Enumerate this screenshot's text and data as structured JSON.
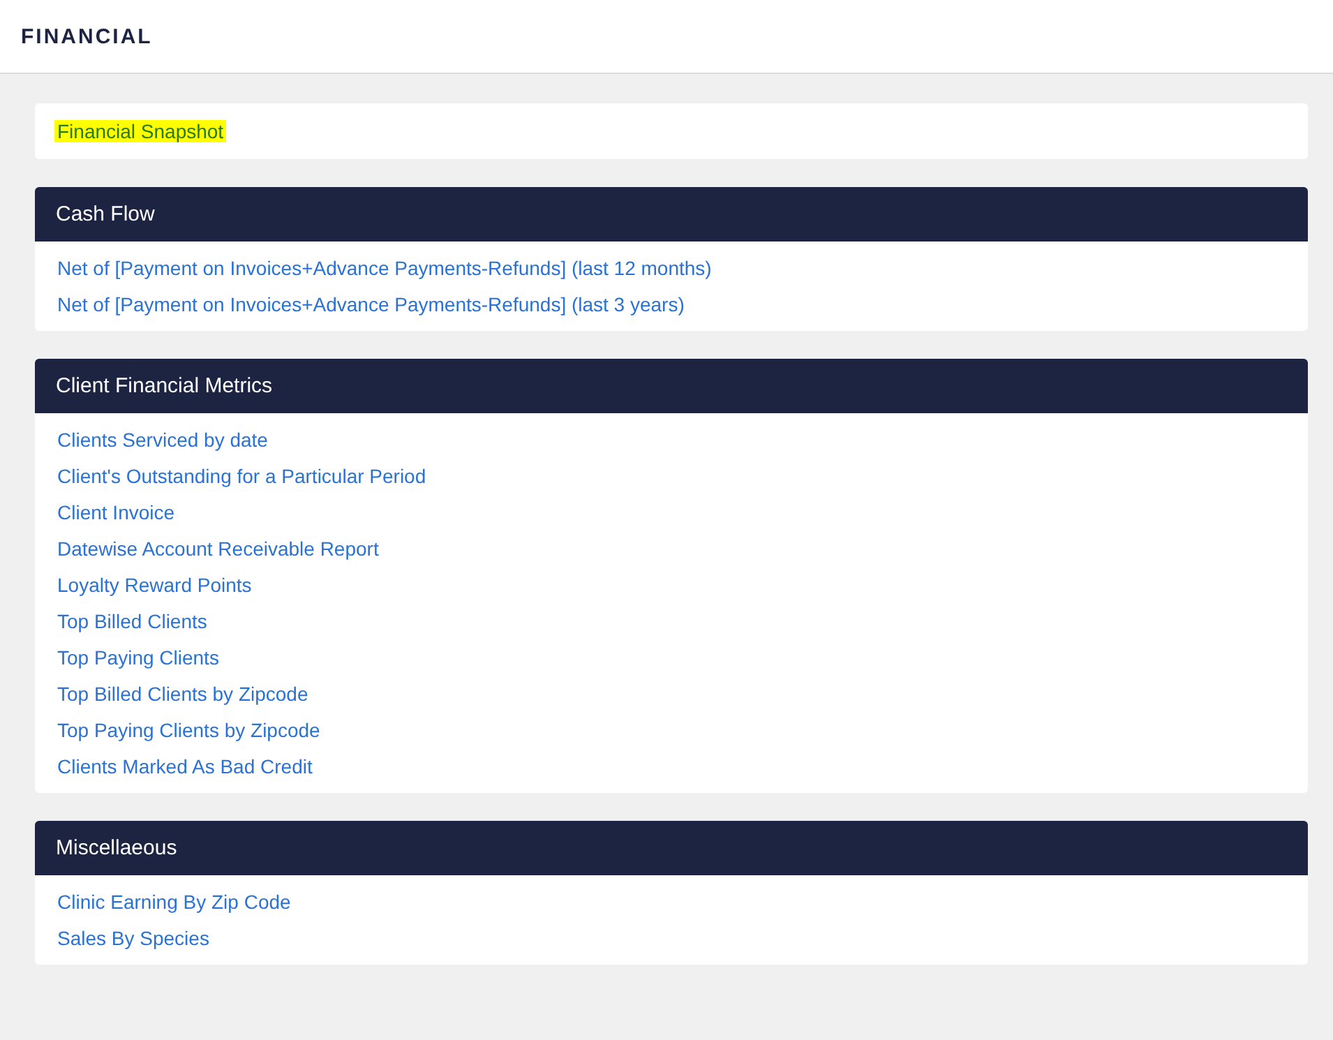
{
  "page_title": "FINANCIAL",
  "snapshot": {
    "label": "Financial Snapshot",
    "highlighted": true
  },
  "sections": [
    {
      "title": "Cash Flow",
      "links": [
        "Net of [Payment on Invoices+Advance Payments-Refunds] (last 12 months)",
        "Net of [Payment on Invoices+Advance Payments-Refunds] (last 3 years)"
      ]
    },
    {
      "title": "Client Financial Metrics",
      "links": [
        "Clients Serviced by date",
        "Client's Outstanding for a Particular Period",
        "Client Invoice",
        "Datewise Account Receivable Report",
        "Loyalty Reward Points",
        "Top Billed Clients",
        "Top Paying Clients",
        "Top Billed Clients by Zipcode",
        "Top Paying Clients by Zipcode",
        "Clients Marked As Bad Credit"
      ]
    },
    {
      "title": "Miscellaeous",
      "links": [
        "Clinic Earning By Zip Code",
        "Sales By Species"
      ]
    }
  ]
}
